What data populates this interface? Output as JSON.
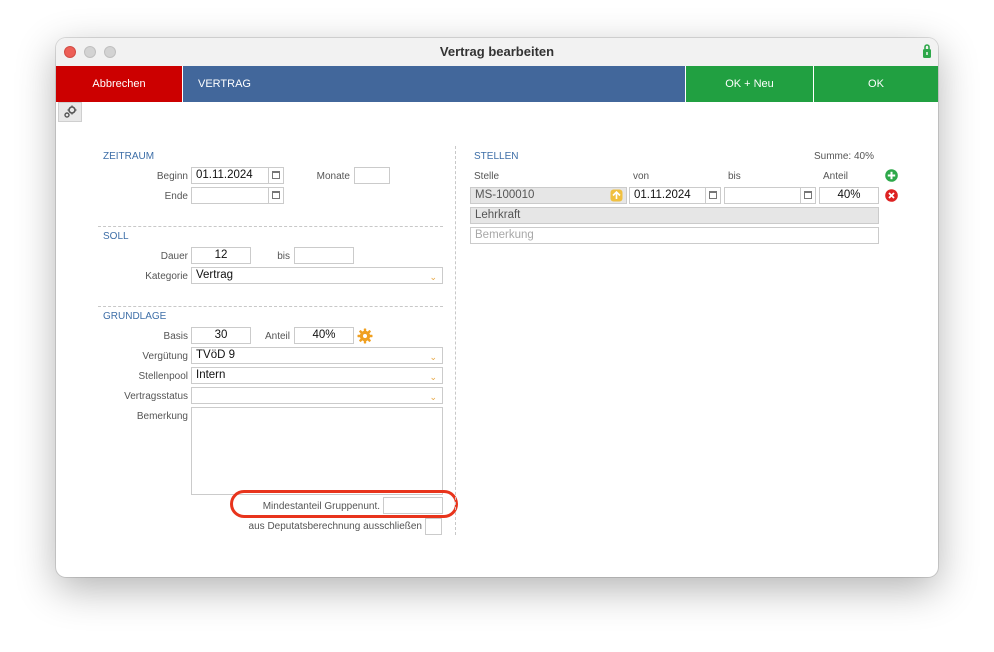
{
  "window": {
    "title": "Vertrag bearbeiten"
  },
  "toolbar": {
    "cancel": "Abbrechen",
    "title": "VERTRAG",
    "ok_new": "OK + Neu",
    "ok": "OK"
  },
  "zeitraum": {
    "heading": "ZEITRAUM",
    "beginn_label": "Beginn",
    "beginn_value": "01.11.2024",
    "monate_label": "Monate",
    "monate_value": "",
    "ende_label": "Ende",
    "ende_value": ""
  },
  "soll": {
    "heading": "SOLL",
    "dauer_label": "Dauer",
    "dauer_value": "12",
    "bis_label": "bis",
    "bis_value": "",
    "kategorie_label": "Kategorie",
    "kategorie_value": "Vertrag"
  },
  "grundlage": {
    "heading": "GRUNDLAGE",
    "basis_label": "Basis",
    "basis_value": "30",
    "anteil_label": "Anteil",
    "anteil_value": "40%",
    "verguetung_label": "Vergütung",
    "verguetung_value": "TVöD 9",
    "stellenpool_label": "Stellenpool",
    "stellenpool_value": "Intern",
    "vertragsstatus_label": "Vertragsstatus",
    "vertragsstatus_value": "",
    "bemerkung_label": "Bemerkung",
    "bemerkung_value": "",
    "mindestanteil_label": "Mindestanteil Gruppenunt.",
    "mindestanteil_value": "",
    "deputat_label": "aus Deputatsberechnung ausschließen"
  },
  "stellen": {
    "heading": "STELLEN",
    "summe": "Summe: 40%",
    "columns": [
      "Stelle",
      "von",
      "bis",
      "Anteil"
    ],
    "rows": [
      {
        "stelle": "MS-100010",
        "von": "01.11.2024",
        "bis": "",
        "anteil": "40%",
        "bezeichnung": "Lehrkraft",
        "bemerkung_placeholder": "Bemerkung"
      }
    ]
  },
  "colors": {
    "cancel": "#cc0000",
    "title_bar": "#42679b",
    "ok": "#21a041",
    "section": "#3d6ea7",
    "highlight": "#e8341c"
  }
}
